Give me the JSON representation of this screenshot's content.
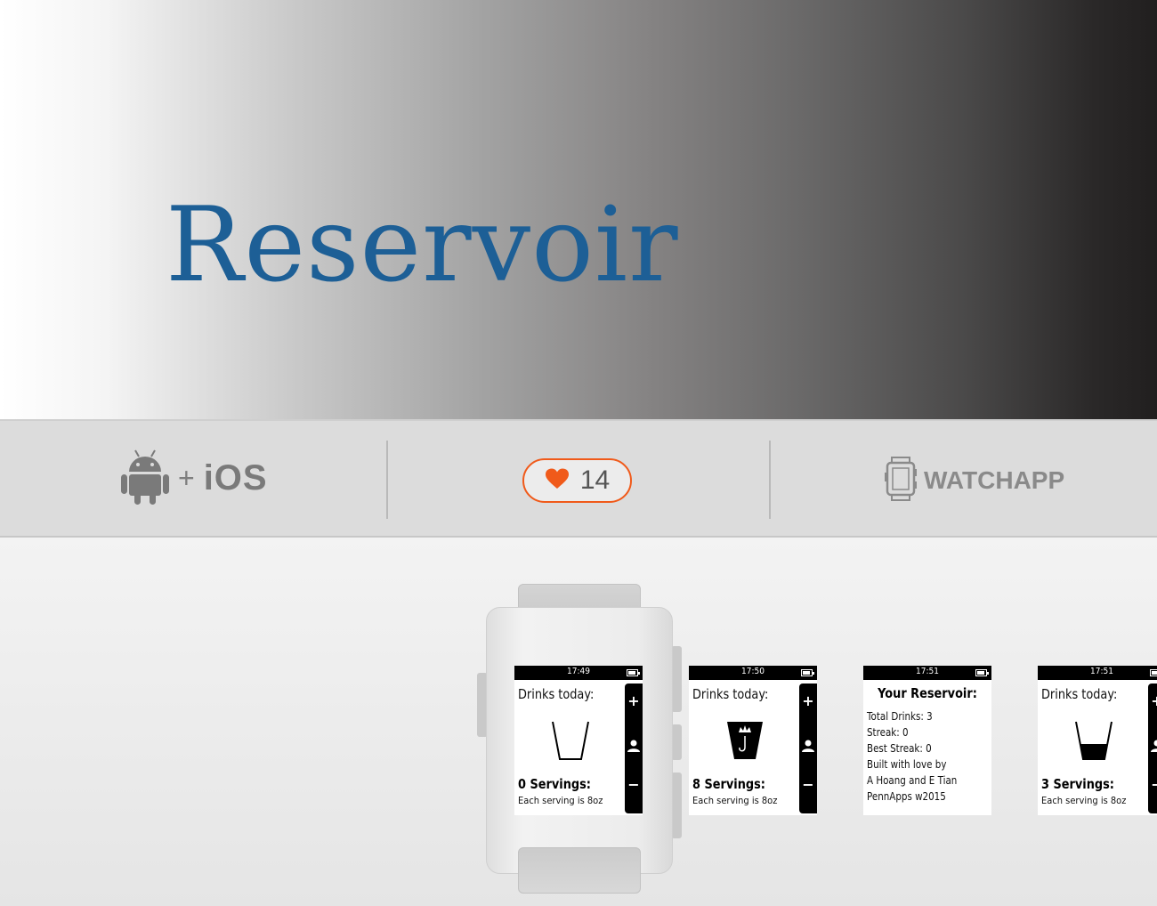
{
  "banner": {
    "title": "Reservoir"
  },
  "infobar": {
    "platform": {
      "android_icon": "android-icon",
      "plus": "+",
      "os": "iOS"
    },
    "hearts": {
      "icon": "heart-icon",
      "count": "14",
      "color": "#f05a1a"
    },
    "type": {
      "icon": "watch-icon",
      "label": "WATCHAPP"
    }
  },
  "screens": [
    {
      "time": "17:49",
      "label": "Drinks today:",
      "servings": "0 Servings:",
      "note": "Each serving is 8oz",
      "cup": "empty-cup-icon"
    },
    {
      "time": "17:50",
      "label": "Drinks today:",
      "servings": "8 Servings:",
      "note": "Each serving is 8oz",
      "cup": "full-cup-crown-icon"
    },
    {
      "time": "17:51",
      "title": "Your Reservoir:",
      "lines": [
        "Total Drinks: 3",
        " Streak: 0",
        " Best Streak: 0",
        " Built with love by",
        " A Hoang and E Tian",
        " PennApps w2015"
      ]
    },
    {
      "time": "17:51",
      "label": "Drinks today:",
      "servings": "3 Servings:",
      "note": "Each serving is 8oz",
      "cup": "partial-cup-icon"
    }
  ],
  "actionbar": {
    "up": "+",
    "select": "person-icon",
    "down": "−"
  },
  "colors": {
    "title_blue": "#1d5f96",
    "accent": "#f05a1a"
  }
}
